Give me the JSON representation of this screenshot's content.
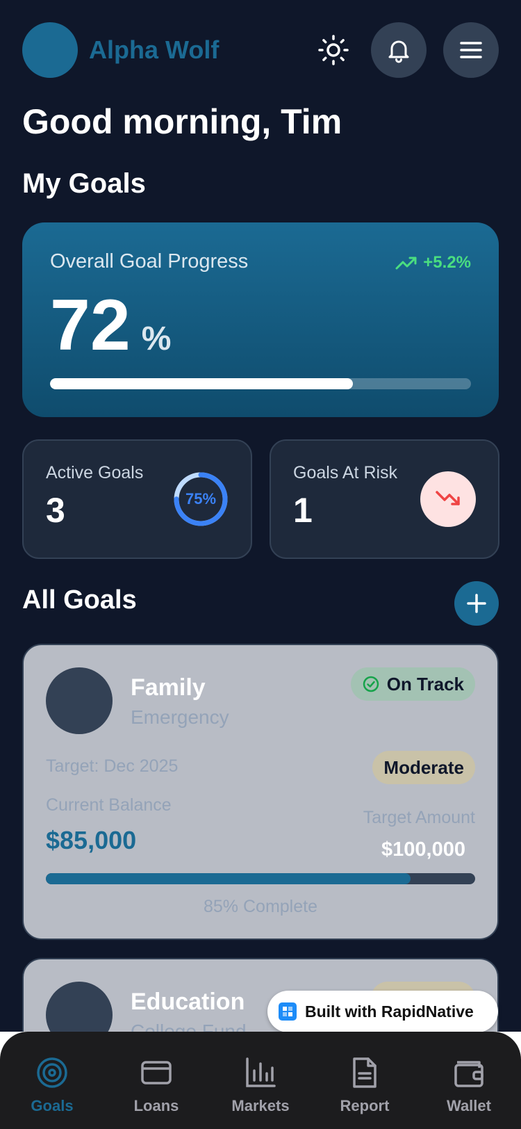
{
  "app": {
    "brand": "Alpha Wolf"
  },
  "greeting": "Good morning, Tim",
  "sections": {
    "my_goals": "My Goals",
    "all_goals": "All Goals"
  },
  "overall": {
    "label": "Overall Goal Progress",
    "trend": "+5.2%",
    "value": "72",
    "unit": "%",
    "progress": 0.72
  },
  "stats": {
    "active": {
      "label": "Active Goals",
      "value": "3",
      "ring_label": "75%",
      "ring_progress": 0.75
    },
    "risk": {
      "label": "Goals At Risk",
      "value": "1"
    }
  },
  "goals": [
    {
      "name": "Family",
      "subtitle": "Emergency",
      "status": "On Track",
      "target_date": "Target: Dec 2025",
      "risk": "Moderate",
      "balance_label": "Current Balance",
      "balance": "$85,000",
      "target_label": "Target Amount",
      "target": "$100,000",
      "progress": 0.85,
      "complete_text": "85% Complete"
    },
    {
      "name": "Education",
      "subtitle": "College Fund"
    }
  ],
  "badge": {
    "text": "Built with RapidNative"
  },
  "nav": [
    {
      "label": "Goals",
      "icon": "target-icon",
      "active": true
    },
    {
      "label": "Loans",
      "icon": "card-icon",
      "active": false
    },
    {
      "label": "Markets",
      "icon": "bar-chart-icon",
      "active": false
    },
    {
      "label": "Report",
      "icon": "document-icon",
      "active": false
    },
    {
      "label": "Wallet",
      "icon": "wallet-icon",
      "active": false
    }
  ],
  "colors": {
    "background": "#0f172a",
    "accent": "#1b6a93",
    "positive": "#4ade80",
    "negative": "#ef4444",
    "ring": "#3b82f6"
  }
}
